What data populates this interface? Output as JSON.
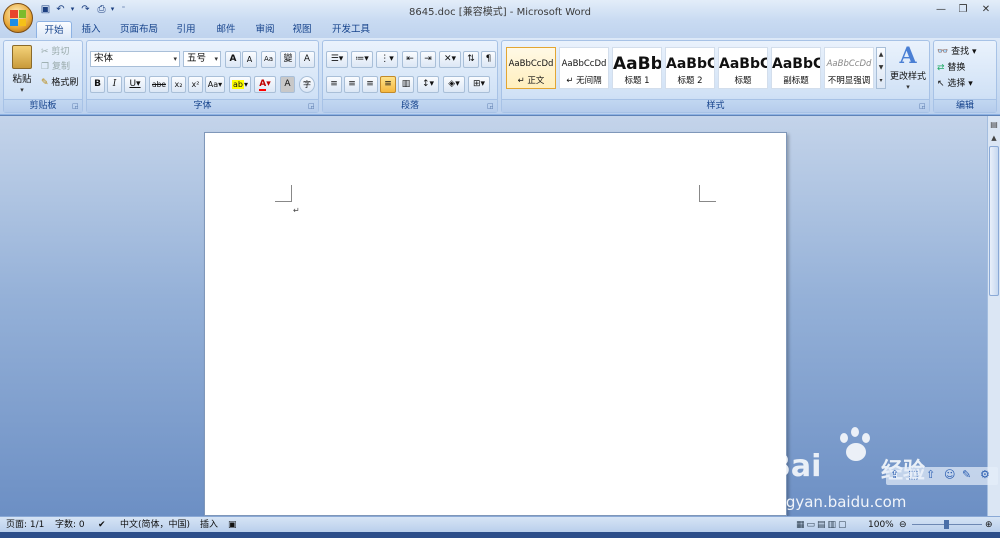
{
  "window": {
    "title": "8645.doc [兼容模式] - Microsoft Word"
  },
  "quick_access": {
    "items": [
      "save-icon",
      "undo-icon",
      "redo-icon",
      "print-preview-icon",
      "customize-icon"
    ]
  },
  "tabs": [
    "开始",
    "插入",
    "页面布局",
    "引用",
    "邮件",
    "审阅",
    "视图",
    "开发工具"
  ],
  "active_tab": "开始",
  "clipboard": {
    "paste": "粘贴",
    "cut": "剪切",
    "copy": "复制",
    "format_painter": "格式刷",
    "label": "剪贴板"
  },
  "font": {
    "name": "宋体",
    "size": "五号",
    "grow": "A",
    "shrink": "A",
    "clear": "Aa",
    "phonetic": "變",
    "border": "A",
    "bold": "B",
    "italic": "I",
    "underline": "U",
    "strike": "abe",
    "subscript": "x₂",
    "superscript": "x²",
    "case": "Aa",
    "highlight": "ab",
    "color": "A",
    "shade": "A",
    "enclosed": "字",
    "label": "字体"
  },
  "paragraph": {
    "label": "段落"
  },
  "styles": {
    "items": [
      {
        "preview": "AaBbCcDd",
        "name": "↵ 正文",
        "selected": true
      },
      {
        "preview": "AaBbCcDd",
        "name": "↵ 无间隔"
      },
      {
        "preview": "AaBb",
        "name": "标题 1"
      },
      {
        "preview": "AaBbC",
        "name": "标题 2"
      },
      {
        "preview": "AaBbC",
        "name": "标题"
      },
      {
        "preview": "AaBbC",
        "name": "副标题"
      },
      {
        "preview": "AaBbCcDd",
        "name": "不明显强调"
      }
    ],
    "change": "更改样式",
    "label": "样式"
  },
  "editing": {
    "find": "查找",
    "replace": "替换",
    "select": "选择",
    "label": "编辑"
  },
  "document": {
    "paragraph_mark": "↵"
  },
  "status": {
    "page": "页面: 1/1",
    "words": "字数: 0",
    "language": "中文(简体，中国)",
    "mode": "插入",
    "zoom": "100%"
  },
  "watermark": {
    "brand": "Bai",
    "brand2": "经验",
    "url": "jingyan.baidu.com"
  },
  "colors": {
    "accent": "#15428b",
    "highlight": "#ffff00",
    "font_color": "#ff0000"
  }
}
